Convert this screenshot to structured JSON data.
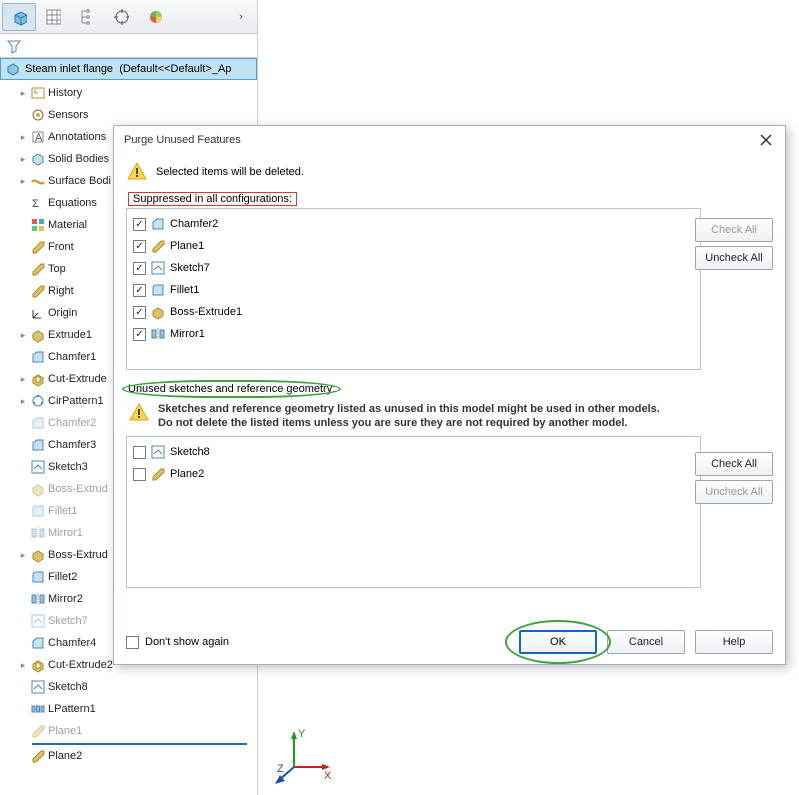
{
  "part": {
    "name": "Steam inlet flange",
    "config_suffix": "(Default<<Default>_Ap"
  },
  "tree": [
    {
      "icon": "history",
      "label": "History",
      "lvl": 1,
      "exp": "▸"
    },
    {
      "icon": "sensor",
      "label": "Sensors",
      "lvl": 1
    },
    {
      "icon": "annot",
      "label": "Annotations",
      "lvl": 1,
      "exp": "▸"
    },
    {
      "icon": "solid",
      "label": "Solid Bodies",
      "lvl": 1,
      "exp": "▸"
    },
    {
      "icon": "surface",
      "label": "Surface Bodi",
      "lvl": 1,
      "exp": "▸"
    },
    {
      "icon": "eq",
      "label": "Equations",
      "lvl": 1
    },
    {
      "icon": "material",
      "label": "Material <no",
      "lvl": 1
    },
    {
      "icon": "plane",
      "label": "Front",
      "lvl": 1
    },
    {
      "icon": "plane",
      "label": "Top",
      "lvl": 1
    },
    {
      "icon": "plane",
      "label": "Right",
      "lvl": 1
    },
    {
      "icon": "origin",
      "label": "Origin",
      "lvl": 1
    },
    {
      "icon": "extrude",
      "label": "Extrude1",
      "lvl": 1,
      "exp": "▸"
    },
    {
      "icon": "chamfer",
      "label": "Chamfer1",
      "lvl": 1
    },
    {
      "icon": "cutext",
      "label": "Cut-Extrude",
      "lvl": 1,
      "exp": "▸"
    },
    {
      "icon": "cirpat",
      "label": "CirPattern1",
      "lvl": 1,
      "exp": "▸"
    },
    {
      "icon": "chamfer",
      "label": "Chamfer2",
      "lvl": 1,
      "sup": true
    },
    {
      "icon": "chamfer",
      "label": "Chamfer3",
      "lvl": 1
    },
    {
      "icon": "sketch",
      "label": "Sketch3",
      "lvl": 1
    },
    {
      "icon": "extrude",
      "label": "Boss-Extrud",
      "lvl": 1,
      "sup": true
    },
    {
      "icon": "fillet",
      "label": "Fillet1",
      "lvl": 1,
      "sup": true
    },
    {
      "icon": "mirror",
      "label": "Mirror1",
      "lvl": 1,
      "sup": true
    },
    {
      "icon": "extrude",
      "label": "Boss-Extrud",
      "lvl": 1,
      "exp": "▸"
    },
    {
      "icon": "fillet",
      "label": "Fillet2",
      "lvl": 1
    },
    {
      "icon": "mirror",
      "label": "Mirror2",
      "lvl": 1
    },
    {
      "icon": "sketch",
      "label": "Sketch7",
      "lvl": 1,
      "sup": true
    },
    {
      "icon": "chamfer",
      "label": "Chamfer4",
      "lvl": 1
    },
    {
      "icon": "cutext",
      "label": "Cut-Extrude2",
      "lvl": 1,
      "exp": "▸"
    },
    {
      "icon": "sketch",
      "label": "Sketch8",
      "lvl": 1
    },
    {
      "icon": "lpat",
      "label": "LPattern1",
      "lvl": 1
    },
    {
      "icon": "plane",
      "label": "Plane1",
      "lvl": 1,
      "sup": true
    },
    {
      "icon": "plane",
      "label": "Plane2",
      "lvl": 1
    }
  ],
  "dialog": {
    "title": "Purge Unused Features",
    "warn1": "Selected items will be deleted.",
    "sec1": "Suppressed in all configurations:",
    "items1": [
      {
        "icon": "chamfer",
        "label": "Chamfer2",
        "checked": true
      },
      {
        "icon": "plane",
        "label": "Plane1",
        "checked": true
      },
      {
        "icon": "sketch",
        "label": "Sketch7",
        "checked": true
      },
      {
        "icon": "fillet",
        "label": "Fillet1",
        "checked": true
      },
      {
        "icon": "extrude",
        "label": "Boss-Extrude1",
        "checked": true
      },
      {
        "icon": "mirror",
        "label": "Mirror1",
        "checked": true
      }
    ],
    "sec2": "Unused sketches and reference geometry:",
    "advice1": "Sketches and reference geometry listed as unused in this model might be used in other models.",
    "advice2": "Do not delete the listed items unless you are sure they are not required by another model.",
    "items2": [
      {
        "icon": "sketch",
        "label": "Sketch8",
        "checked": false
      },
      {
        "icon": "plane",
        "label": "Plane2",
        "checked": false
      }
    ],
    "check_all": "Check All",
    "uncheck_all": "Uncheck All",
    "dont_show": "Don't show again",
    "ok": "OK",
    "cancel": "Cancel",
    "help": "Help"
  },
  "triad": {
    "x": "X",
    "y": "Y",
    "z": "Z"
  }
}
